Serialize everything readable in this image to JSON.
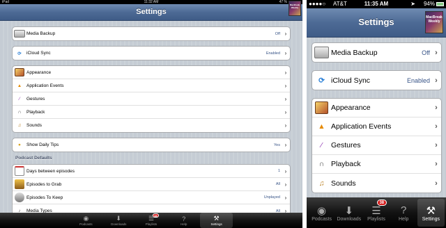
{
  "ipad": {
    "status": {
      "carrier": "iPad",
      "time": "11:32 AM",
      "battery": "47 %"
    },
    "title": "Settings",
    "thumb_text": "MacBreak Weekly",
    "groups": [
      [
        {
          "label": "Media Backup",
          "value": "Off",
          "icon": "drive-icon"
        }
      ],
      [
        {
          "label": "iCloud Sync",
          "value": "Enabled",
          "icon": "icloud-sync-icon"
        }
      ],
      [
        {
          "label": "Appearance",
          "value": "",
          "icon": "appearance-icon"
        },
        {
          "label": "Application Events",
          "value": "",
          "icon": "warning-icon"
        },
        {
          "label": "Gestures",
          "value": "",
          "icon": "wand-icon"
        },
        {
          "label": "Playback",
          "value": "",
          "icon": "headphones-icon"
        },
        {
          "label": "Sounds",
          "value": "",
          "icon": "gramophone-icon"
        }
      ],
      [
        {
          "label": "Show Daily Tips",
          "value": "Yes",
          "icon": "lightbulb-icon"
        }
      ]
    ],
    "section_header": "Podcast Defaults",
    "podcast_group": [
      {
        "label": "Days between episodes",
        "value": "1",
        "icon": "calendar-icon"
      },
      {
        "label": "Episodes to Grab",
        "value": "All",
        "icon": "grab-icon"
      },
      {
        "label": "Episodes To Keep",
        "value": "Unplayed",
        "icon": "keep-icon"
      },
      {
        "label": "Media Types",
        "value": "All",
        "icon": "media-types-icon"
      }
    ]
  },
  "iphone": {
    "status": {
      "carrier": "AT&T",
      "time": "11:35 AM",
      "battery": "94%"
    },
    "title": "Settings",
    "thumb_text": "MacBreak Weekly",
    "groups": [
      [
        {
          "label": "Media Backup",
          "value": "Off",
          "icon": "drive-icon"
        }
      ],
      [
        {
          "label": "iCloud Sync",
          "value": "Enabled",
          "icon": "icloud-sync-icon"
        }
      ],
      [
        {
          "label": "Appearance",
          "value": "",
          "icon": "appearance-icon"
        },
        {
          "label": "Application Events",
          "value": "",
          "icon": "warning-icon"
        },
        {
          "label": "Gestures",
          "value": "",
          "icon": "wand-icon"
        },
        {
          "label": "Playback",
          "value": "",
          "icon": "headphones-icon"
        },
        {
          "label": "Sounds",
          "value": "",
          "icon": "gramophone-icon"
        }
      ]
    ]
  },
  "tabs": [
    {
      "label": "Podcasts",
      "icon": "podcast-icon",
      "badge": "",
      "active": false
    },
    {
      "label": "Downloads",
      "icon": "download-icon",
      "badge": "",
      "active": false
    },
    {
      "label": "Playlists",
      "icon": "playlists-icon",
      "badge": "38",
      "active": false
    },
    {
      "label": "Help",
      "icon": "help-icon",
      "badge": "",
      "active": false
    },
    {
      "label": "Settings",
      "icon": "settings-icon",
      "badge": "",
      "active": true
    }
  ],
  "colors": {
    "navbar": "#4d6a95",
    "value_text": "#385487",
    "badge": "#d41b1b",
    "table_bg": "#c5ccd4"
  }
}
